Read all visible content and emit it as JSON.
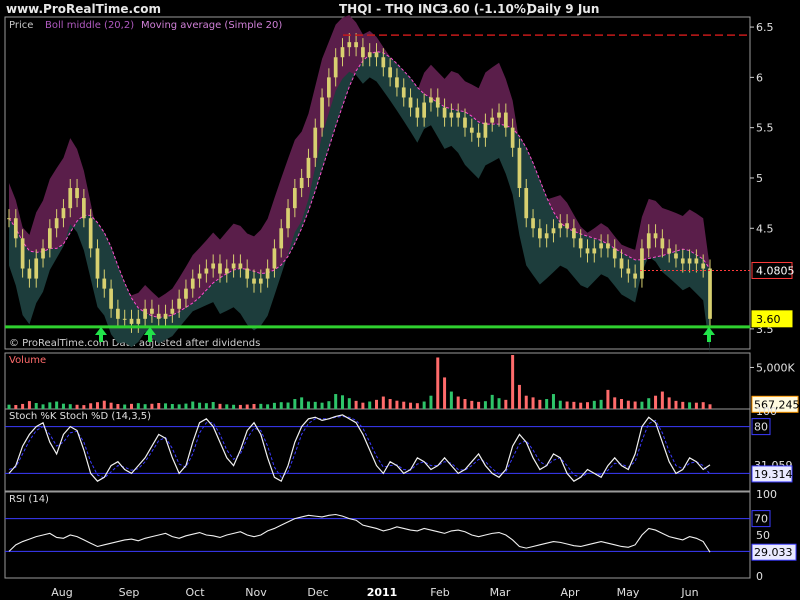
{
  "header": {
    "site": "www.ProRealTime.com",
    "symbol": "THQI - THQ INC.",
    "price": "3.60 (-1.10%)",
    "period": "Daily 9 Jun"
  },
  "chart_data": [
    {
      "type": "candlestick",
      "panel": "price",
      "legend": [
        "Price",
        "Boll middle (20,2)",
        "Moving average (Simple 20)"
      ],
      "watermark": "© ProRealTime.com  Data adjusted after dividends",
      "ylim": [
        3.3,
        6.6
      ],
      "y_ticks": [
        "6.5",
        "6",
        "5.5",
        "5",
        "4.5",
        "3.5"
      ],
      "y_tick_values": [
        6.5,
        6,
        5.5,
        5,
        4.5,
        3.5
      ],
      "markers": [
        {
          "label": "4.0805",
          "value": 4.0805,
          "color": "#ff3b3b"
        },
        {
          "label": "3.60",
          "value": 3.6,
          "color": "#ffff00"
        }
      ],
      "resistance_line": 6.42,
      "support_line": 3.52,
      "close_series": [
        4.6,
        4.4,
        4.1,
        4.0,
        4.2,
        4.3,
        4.5,
        4.6,
        4.7,
        4.9,
        4.8,
        4.6,
        4.3,
        4.0,
        3.9,
        3.7,
        3.6,
        3.6,
        3.55,
        3.6,
        3.7,
        3.65,
        3.6,
        3.65,
        3.7,
        3.8,
        3.9,
        4.0,
        4.05,
        4.1,
        4.15,
        4.05,
        4.1,
        4.15,
        4.1,
        4.0,
        3.95,
        4.0,
        4.1,
        4.3,
        4.5,
        4.7,
        4.9,
        5.0,
        5.2,
        5.5,
        5.8,
        6.0,
        6.2,
        6.3,
        6.35,
        6.3,
        6.2,
        6.25,
        6.2,
        6.1,
        6.0,
        5.9,
        5.8,
        5.7,
        5.6,
        5.75,
        5.8,
        5.7,
        5.6,
        5.65,
        5.6,
        5.5,
        5.45,
        5.4,
        5.55,
        5.6,
        5.65,
        5.5,
        5.3,
        4.9,
        4.6,
        4.5,
        4.4,
        4.45,
        4.5,
        4.55,
        4.5,
        4.4,
        4.3,
        4.25,
        4.3,
        4.35,
        4.3,
        4.2,
        4.1,
        4.05,
        4.0,
        4.3,
        4.45,
        4.4,
        4.3,
        4.25,
        4.2,
        4.15,
        4.2,
        4.15,
        4.1,
        3.6
      ],
      "buy_signals": [
        "Aug",
        "Sep",
        "Jun"
      ]
    },
    {
      "type": "bar",
      "panel": "volume",
      "legend": [
        "Volume"
      ],
      "y_ticks": [
        "5,000K"
      ],
      "y_tick_values": [
        5000
      ],
      "last_value": "567,245",
      "last_value_k": 567.245,
      "ylim": [
        0,
        6500
      ],
      "values": [
        520,
        480,
        610,
        950,
        720,
        560,
        800,
        900,
        640,
        580,
        510,
        470,
        690,
        820,
        1000,
        760,
        600,
        540,
        620,
        700,
        580,
        630,
        720,
        680,
        600,
        560,
        650,
        900,
        760,
        700,
        840,
        620,
        560,
        510,
        490,
        540,
        600,
        620,
        560,
        740,
        820,
        780,
        1200,
        1400,
        900,
        860,
        760,
        940,
        1800,
        1650,
        1300,
        980,
        760,
        900,
        1100,
        1500,
        1200,
        1000,
        880,
        760,
        700,
        900,
        1600,
        6200,
        3800,
        2100,
        1500,
        1200,
        980,
        860,
        940,
        1700,
        1300,
        1100,
        6500,
        2900,
        1600,
        1400,
        1100,
        1200,
        1800,
        1000,
        900,
        860,
        760,
        820,
        980,
        1100,
        2300,
        1400,
        1200,
        1000,
        900,
        880,
        1300,
        1600,
        2100,
        1400,
        980,
        860,
        800,
        760,
        820,
        567
      ]
    },
    {
      "type": "line",
      "panel": "stochastic",
      "legend": [
        "Stoch %K Stoch %D (14,3,5)"
      ],
      "ylim": [
        0,
        100
      ],
      "y_ticks": [
        "100",
        "80",
        "31.059",
        "19.314"
      ],
      "levels": [
        80,
        20
      ],
      "last_k": 31.059,
      "last_d": 19.314,
      "k_series": [
        20,
        30,
        55,
        70,
        80,
        85,
        60,
        45,
        70,
        80,
        75,
        50,
        20,
        10,
        15,
        30,
        35,
        25,
        20,
        30,
        40,
        55,
        70,
        65,
        40,
        20,
        30,
        60,
        85,
        90,
        80,
        60,
        40,
        30,
        50,
        75,
        85,
        70,
        40,
        15,
        10,
        30,
        60,
        80,
        90,
        92,
        88,
        90,
        93,
        95,
        90,
        85,
        70,
        50,
        30,
        20,
        35,
        30,
        20,
        25,
        40,
        35,
        25,
        30,
        40,
        30,
        20,
        25,
        35,
        45,
        30,
        20,
        15,
        25,
        55,
        70,
        60,
        40,
        25,
        30,
        45,
        40,
        20,
        10,
        15,
        25,
        20,
        15,
        30,
        40,
        30,
        25,
        45,
        80,
        92,
        85,
        60,
        35,
        20,
        25,
        40,
        35,
        25,
        31
      ],
      "d_series": [
        25,
        28,
        45,
        62,
        75,
        80,
        70,
        55,
        60,
        72,
        74,
        60,
        35,
        18,
        14,
        22,
        30,
        28,
        24,
        26,
        35,
        48,
        62,
        66,
        52,
        32,
        28,
        45,
        72,
        85,
        85,
        70,
        50,
        38,
        45,
        65,
        78,
        75,
        55,
        28,
        15,
        22,
        45,
        70,
        84,
        90,
        90,
        90,
        92,
        93,
        92,
        88,
        78,
        60,
        42,
        28,
        30,
        31,
        25,
        24,
        32,
        35,
        30,
        30,
        35,
        33,
        25,
        24,
        30,
        38,
        35,
        26,
        19,
        22,
        40,
        58,
        62,
        50,
        35,
        30,
        37,
        40,
        30,
        18,
        15,
        20,
        20,
        18,
        24,
        33,
        32,
        28,
        35,
        62,
        84,
        88,
        72,
        48,
        30,
        26,
        33,
        35,
        30,
        19
      ]
    },
    {
      "type": "line",
      "panel": "rsi",
      "legend": [
        "RSI (14)"
      ],
      "ylim": [
        0,
        100
      ],
      "y_ticks": [
        "100",
        "70",
        "50",
        "29.033",
        "0"
      ],
      "levels": [
        70,
        30
      ],
      "last_value": 29.033,
      "series": [
        30,
        38,
        42,
        45,
        48,
        50,
        52,
        47,
        46,
        50,
        48,
        44,
        40,
        36,
        38,
        40,
        42,
        44,
        45,
        43,
        46,
        48,
        50,
        52,
        48,
        46,
        49,
        51,
        53,
        50,
        49,
        47,
        50,
        52,
        54,
        50,
        48,
        50,
        55,
        58,
        62,
        66,
        70,
        72,
        74,
        73,
        72,
        74,
        75,
        73,
        70,
        68,
        62,
        60,
        58,
        55,
        57,
        60,
        58,
        56,
        55,
        58,
        56,
        54,
        52,
        55,
        56,
        54,
        50,
        48,
        50,
        52,
        53,
        50,
        44,
        36,
        34,
        36,
        38,
        40,
        42,
        41,
        39,
        37,
        36,
        38,
        40,
        42,
        40,
        38,
        36,
        35,
        38,
        50,
        58,
        56,
        52,
        48,
        46,
        44,
        48,
        46,
        42,
        29
      ]
    },
    {
      "type": "axis",
      "panel": "time",
      "x_ticks": [
        "Aug",
        "Sep",
        "Oct",
        "Nov",
        "Dec",
        "2011",
        "Feb",
        "Mar",
        "Apr",
        "May",
        "Jun"
      ]
    }
  ],
  "colors": {
    "background": "#000000",
    "candle": "#d8d070",
    "band_upper": "#5a1e4a",
    "band_lower": "#1d3d3c",
    "boll_middle": "#ff4fd0",
    "support": "#2fd02f",
    "resistance": "#c41a1a",
    "volume_up": "#2ec46a",
    "volume_down": "#ff6b6b",
    "stoch_k": "#f0f0f0",
    "stoch_d": "#3b3bff",
    "level_line": "#3b3bff",
    "text_gray": "#c8c8c8",
    "price_marker": "#ffff00",
    "last_marker": "#ff3b3b"
  }
}
